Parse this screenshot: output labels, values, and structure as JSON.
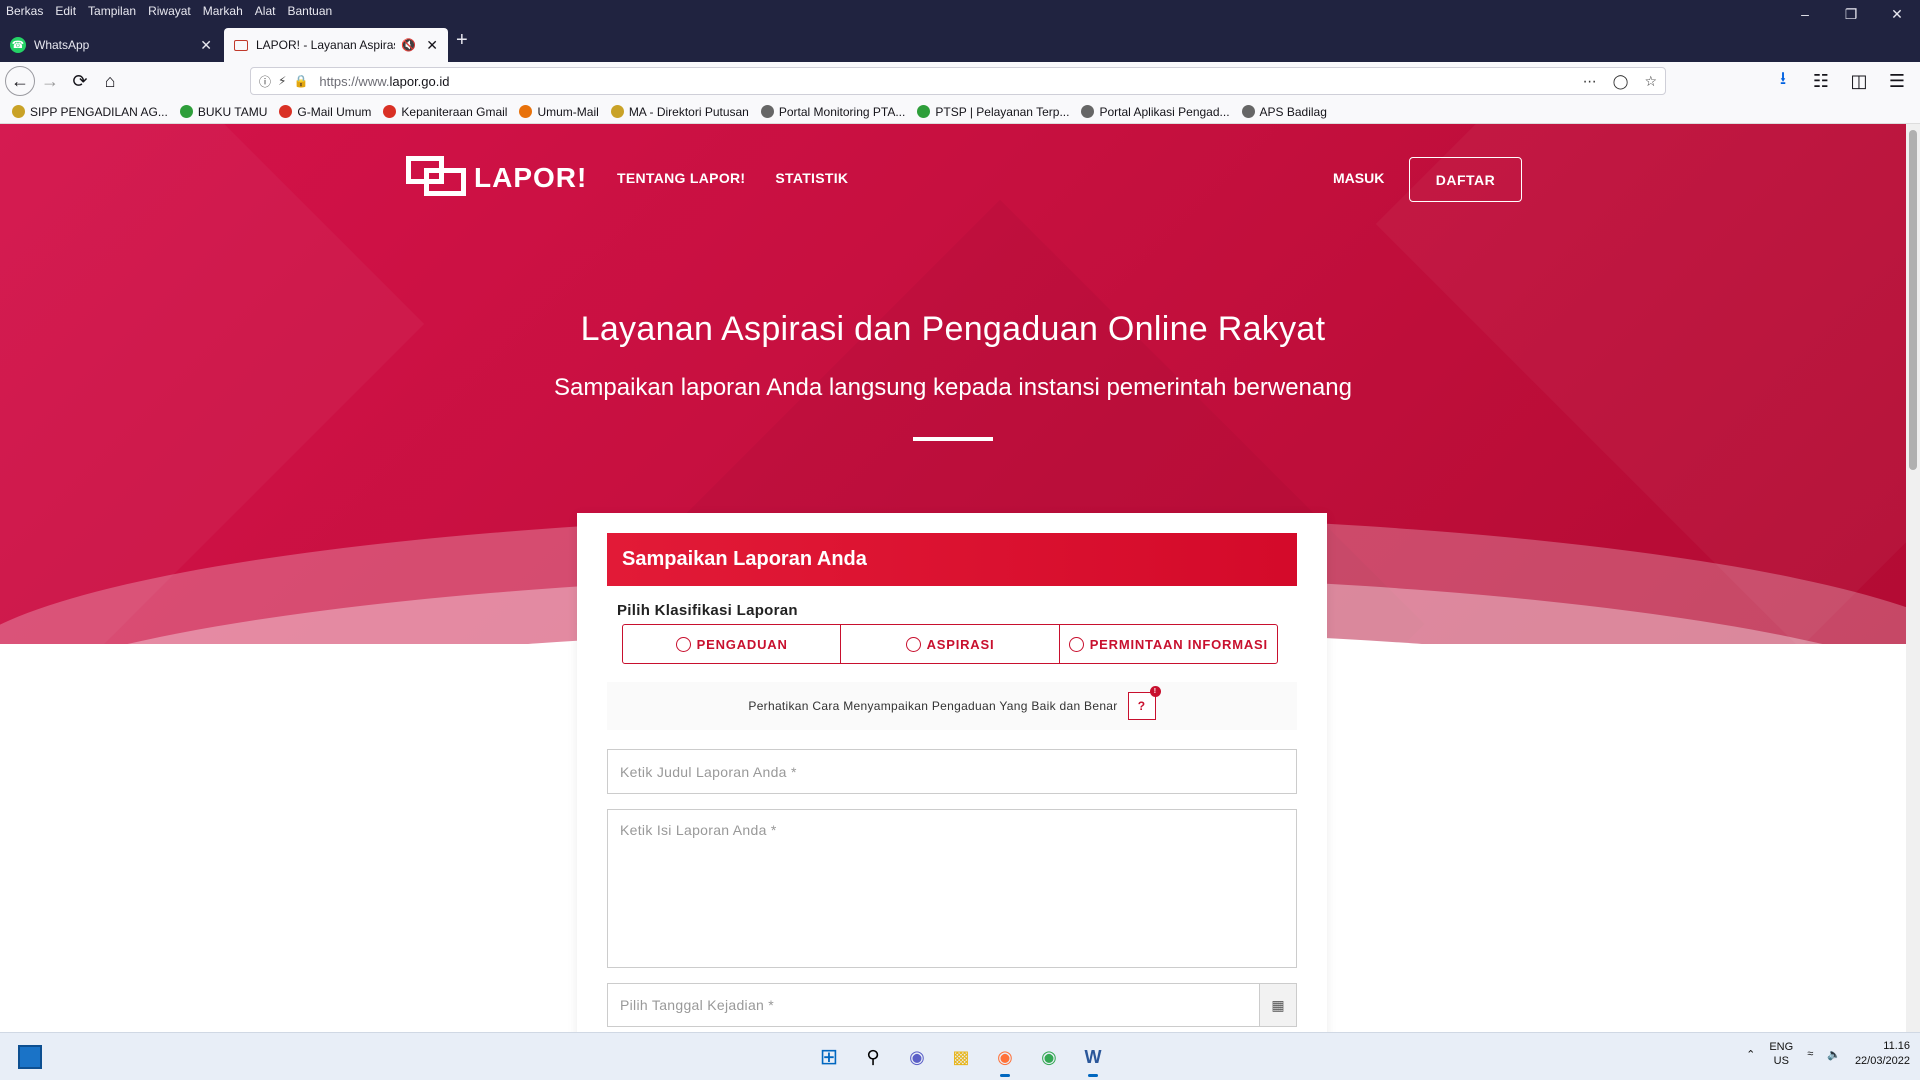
{
  "browser": {
    "menu": [
      "Berkas",
      "Edit",
      "Tampilan",
      "Riwayat",
      "Markah",
      "Alat",
      "Bantuan"
    ],
    "tabs": [
      {
        "title": "WhatsApp",
        "active": false
      },
      {
        "title": "LAPOR! - Layanan Aspirasi d",
        "active": true
      }
    ],
    "url_scheme": "https://www.",
    "url_host": "lapor.go.id",
    "bookmarks": [
      {
        "label": "SIPP PENGADILAN AG...",
        "color": "#c9a227"
      },
      {
        "label": "BUKU TAMU",
        "color": "#2e9e3a"
      },
      {
        "label": "G-Mail Umum",
        "color": "#d93025"
      },
      {
        "label": "Kepaniteraan Gmail",
        "color": "#d93025"
      },
      {
        "label": "Umum-Mail",
        "color": "#e8710a"
      },
      {
        "label": "MA - Direktori Putusan",
        "color": "#c9a227"
      },
      {
        "label": "Portal Monitoring PTA...",
        "color": "#666666"
      },
      {
        "label": "PTSP | Pelayanan Terp...",
        "color": "#2e9e3a"
      },
      {
        "label": "Portal Aplikasi Pengad...",
        "color": "#666666"
      },
      {
        "label": "APS Badilag",
        "color": "#666666"
      }
    ]
  },
  "site": {
    "logo_text": "LAPOR!",
    "nav": [
      "TENTANG LAPOR!",
      "STATISTIK"
    ],
    "login": "MASUK",
    "register": "DAFTAR",
    "hero_title": "Layanan Aspirasi dan Pengaduan Online Rakyat",
    "hero_subtitle": "Sampaikan laporan Anda langsung kepada instansi pemerintah berwenang",
    "brand_color": "#c8102e"
  },
  "form": {
    "header": "Sampaikan Laporan Anda",
    "classification_label": "Pilih Klasifikasi Laporan",
    "options": [
      "PENGADUAN",
      "ASPIRASI",
      "PERMINTAAN INFORMASI"
    ],
    "notice": "Perhatikan Cara Menyampaikan Pengaduan Yang Baik dan Benar",
    "help_label": "?",
    "help_badge": "!",
    "title_placeholder": "Ketik Judul Laporan Anda *",
    "body_placeholder": "Ketik Isi Laporan Anda *",
    "date_placeholder": "Pilih Tanggal Kejadian *"
  },
  "taskbar": {
    "lang_top": "ENG",
    "lang_bottom": "US",
    "time": "11.16",
    "date": "22/03/2022"
  }
}
